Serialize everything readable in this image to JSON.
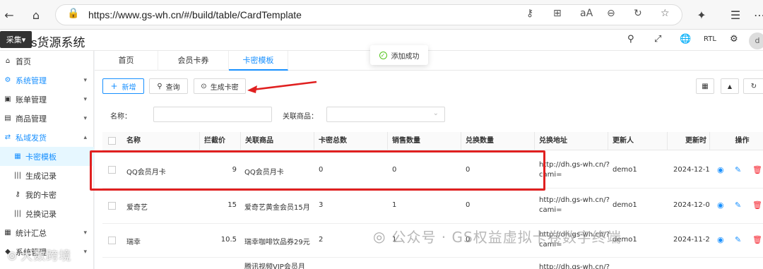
{
  "browser": {
    "url": "https://www.gs-wh.cn/#/build/table/CardTemplate"
  },
  "header": {
    "logo_text": "采集",
    "brand": "s货源系统",
    "rtl": "RTL",
    "avatar": "d"
  },
  "sidebar": {
    "items": [
      {
        "label": "首页",
        "icon": "home-icon"
      },
      {
        "label": "系统管理",
        "icon": "gears-icon"
      },
      {
        "label": "账单管理",
        "icon": "bill-icon"
      },
      {
        "label": "商品管理",
        "icon": "product-icon"
      },
      {
        "label": "私域发货",
        "icon": "shuffle-icon"
      },
      {
        "label": "卡密模板",
        "icon": "card-icon"
      },
      {
        "label": "生成记录",
        "icon": "barcode-icon"
      },
      {
        "label": "我的卡密",
        "icon": "key-icon"
      },
      {
        "label": "兑换记录",
        "icon": "barcode-icon"
      },
      {
        "label": "统计汇总",
        "icon": "table-icon"
      },
      {
        "label": "系统管理",
        "icon": "tag-icon"
      }
    ]
  },
  "tabs": [
    "首页",
    "会员卡券",
    "卡密模板"
  ],
  "toast": {
    "message": "添加成功"
  },
  "toolbar": {
    "add": "新增",
    "query": "查询",
    "generate": "生成卡密"
  },
  "filters": {
    "name_label": "名称：",
    "product_label": "关联商品："
  },
  "table": {
    "headers": [
      "名称",
      "拦截价",
      "关联商品",
      "卡密总数",
      "销售数量",
      "兑换数量",
      "兑换地址",
      "更新人",
      "更新时",
      "操作"
    ],
    "rows": [
      {
        "name": "QQ会员月卡",
        "price": "9",
        "product": "QQ会员月卡",
        "total": "0",
        "sold": "0",
        "redeemed": "0",
        "address1": "http://dh.gs-wh.cn/?",
        "address2": "cami=",
        "updater": "demo1",
        "time": "2024-12-1("
      },
      {
        "name": "爱奇艺",
        "price": "15",
        "product": "爱奇艺黄金会员15月",
        "total": "3",
        "sold": "1",
        "redeemed": "0",
        "address1": "http://dh.gs-wh.cn/?",
        "address2": "cami=",
        "updater": "demo1",
        "time": "2024-12-0("
      },
      {
        "name": "瑞幸",
        "price": "10.5",
        "product": "瑞幸咖啡饮品券29元",
        "total": "2",
        "sold": "1",
        "redeemed": "0",
        "address1": "http://dh.gs-wh.cn/?",
        "address2": "cami=",
        "updater": "demo1",
        "time": "2024-11-2"
      },
      {
        "name": "",
        "price": "",
        "product": "腾讯视频VIP会员月",
        "total": "",
        "sold": "",
        "redeemed": "",
        "address1": "http://dh.gs-wh.cn/?",
        "address2": "",
        "updater": "",
        "time": ""
      }
    ]
  },
  "watermarks": {
    "right": "公众号 · GS权益虚拟卡卷数字终端",
    "left": "大数跨境"
  },
  "colors": {
    "accent": "#1890ff",
    "highlight": "#e02020"
  }
}
